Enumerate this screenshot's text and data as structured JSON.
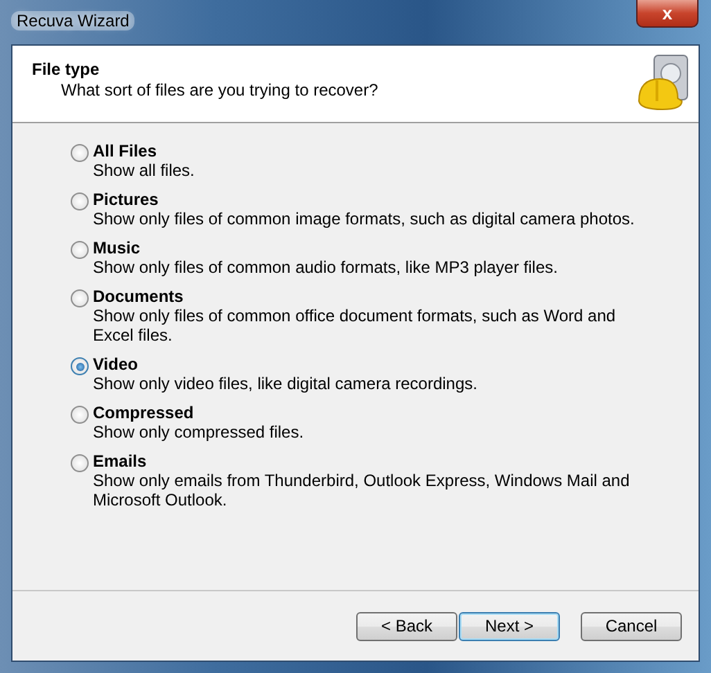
{
  "window": {
    "title": "Recuva Wizard",
    "close": "x"
  },
  "header": {
    "title": "File type",
    "subtitle": "What sort of files are you trying to recover?"
  },
  "options": [
    {
      "label": "All Files",
      "description": "Show all files.",
      "selected": false
    },
    {
      "label": "Pictures",
      "description": "Show only files of common image formats, such as digital camera photos.",
      "selected": false
    },
    {
      "label": "Music",
      "description": "Show only files of common audio formats, like MP3 player files.",
      "selected": false
    },
    {
      "label": "Documents",
      "description": "Show only files of common office document formats, such as Word and Excel files.",
      "selected": false
    },
    {
      "label": "Video",
      "description": "Show only video files, like digital camera recordings.",
      "selected": true
    },
    {
      "label": "Compressed",
      "description": "Show only compressed files.",
      "selected": false
    },
    {
      "label": "Emails",
      "description": "Show only emails from Thunderbird, Outlook Express, Windows Mail and Microsoft Outlook.",
      "selected": false
    }
  ],
  "buttons": [
    {
      "label": "< Back",
      "default": false
    },
    {
      "label": "Next >",
      "default": true
    },
    {
      "label": "Cancel",
      "default": false
    }
  ]
}
